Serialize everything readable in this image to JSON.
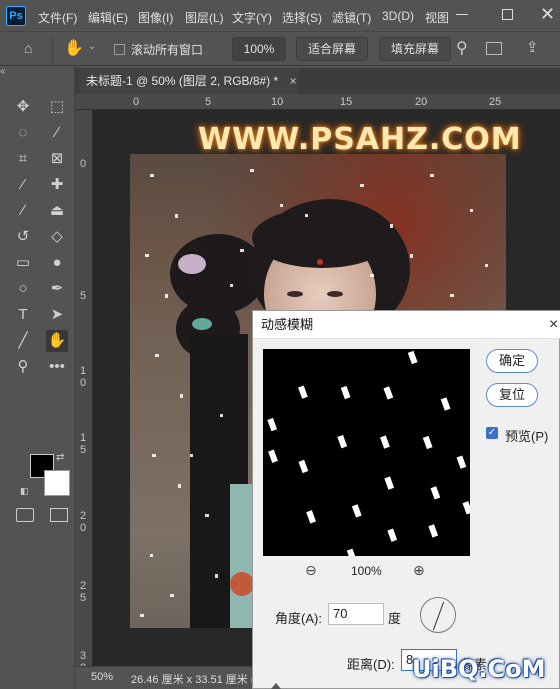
{
  "app": {
    "logo": "Ps"
  },
  "menu": [
    "文件(F)",
    "编辑(E)",
    "图像(I)",
    "图层(L)",
    "文字(Y)",
    "选择(S)",
    "滤镜(T)",
    "3D(D)",
    "视图"
  ],
  "options": {
    "scroll_all_label": "滚动所有窗口",
    "zoom_value": "100%",
    "fit_screen_label": "适合屏幕",
    "fill_screen_label": "填充屏幕"
  },
  "document": {
    "tab_title": "未标题-1 @ 50% (图层 2, RGB/8#) *",
    "close_glyph": "×"
  },
  "rulers": {
    "h_ticks": [
      "0",
      "5",
      "10",
      "15",
      "20",
      "25"
    ],
    "v_ticks": [
      "0",
      "5",
      "1\n0",
      "1\n5",
      "2\n0",
      "2\n5",
      "3\n0",
      "3\n5"
    ]
  },
  "status": {
    "zoom": "50%",
    "doc_size": "26.46 厘米 x 33.51 厘米 (72"
  },
  "dialog": {
    "title": "动感模糊",
    "close_glyph": "×",
    "ok_label": "确定",
    "reset_label": "复位",
    "preview_label": "预览(P)",
    "zoom_value": "100%",
    "angle_label": "角度(A):",
    "angle_value": "70",
    "angle_unit": "度",
    "distance_label": "距离(D):",
    "distance_value": "8",
    "distance_unit": "像素"
  },
  "watermarks": {
    "top": "WWW.PSAHZ.COM",
    "bottom": "UiBQ.CoM"
  },
  "colors": {
    "foreground": "#000000",
    "background": "#ffffff",
    "accent": "#31a8ff",
    "dialog_button_border": "#5a8bd6"
  },
  "icons": [
    "move-icon",
    "marquee-icon",
    "lasso-icon",
    "magic-wand-icon",
    "crop-icon",
    "frame-icon",
    "eyedropper-icon",
    "healing-icon",
    "brush-icon",
    "stamp-icon",
    "history-brush-icon",
    "eraser-icon",
    "gradient-icon",
    "blur-icon",
    "dodge-icon",
    "pen-icon",
    "type-icon",
    "path-select-icon",
    "line-icon",
    "hand-icon",
    "zoom-icon",
    "more-icon"
  ]
}
